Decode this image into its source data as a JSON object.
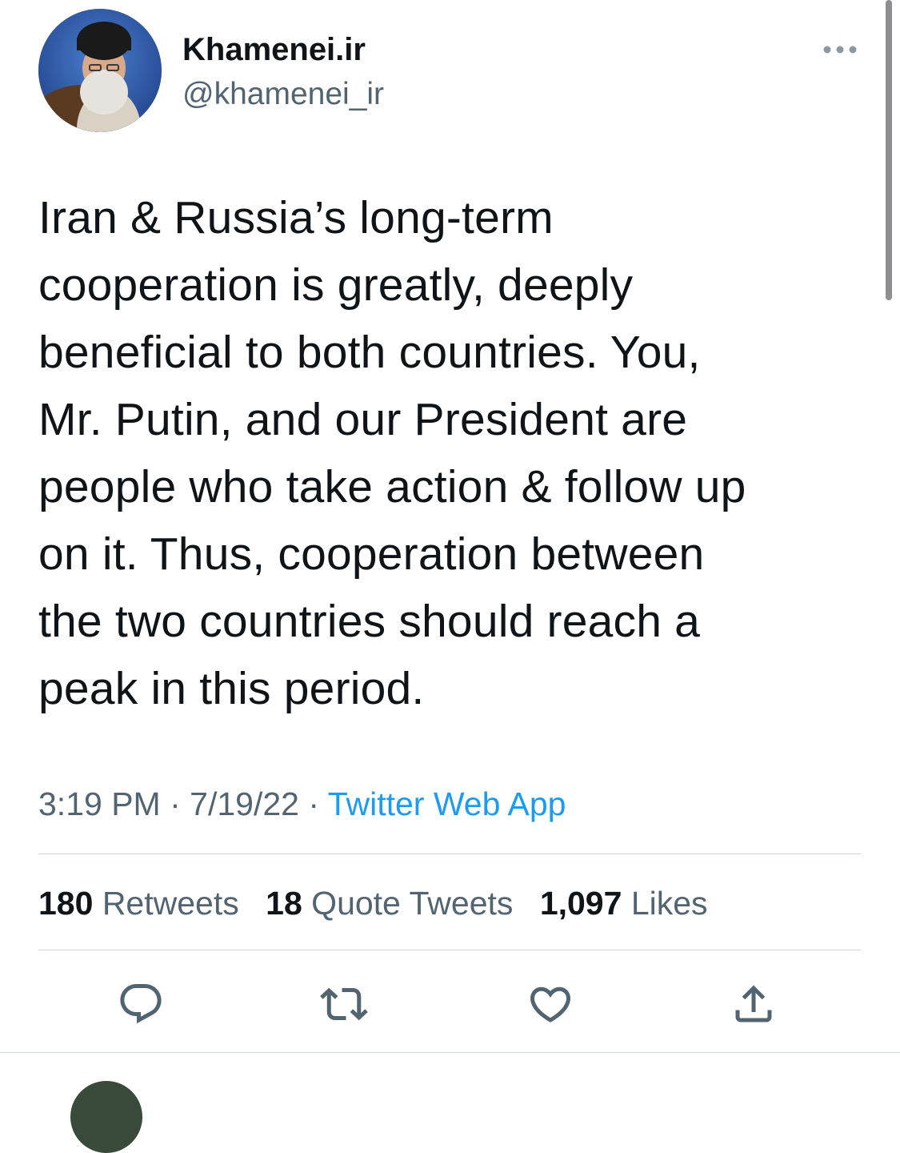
{
  "author": {
    "display_name": "Khamenei.ir",
    "handle": "@khamenei_ir"
  },
  "tweet": {
    "text_lines": [
      "Iran & Russia’s long-term",
      "cooperation is greatly, deeply",
      "beneficial to both countries. You,",
      "Mr. Putin, and our President are",
      "people who take action & follow up",
      "on it. Thus, cooperation between",
      "the two countries should reach a",
      "peak in this period."
    ],
    "time": "3:19 PM",
    "date": "7/19/22",
    "separator": "·",
    "source": "Twitter Web App"
  },
  "stats": {
    "retweets_count": "180",
    "retweets_label": "Retweets",
    "quote_count": "18",
    "quote_label": "Quote Tweets",
    "likes_count": "1,097",
    "likes_label": "Likes"
  },
  "icons": {
    "more": "more-horizontal-icon",
    "reply": "reply-icon",
    "retweet": "retweet-icon",
    "like": "heart-icon",
    "share": "share-icon"
  },
  "colors": {
    "text": "#0f1419",
    "secondary": "#536471",
    "link": "#1d9bf0",
    "divider": "#cfd9de",
    "icon": "#536471"
  }
}
